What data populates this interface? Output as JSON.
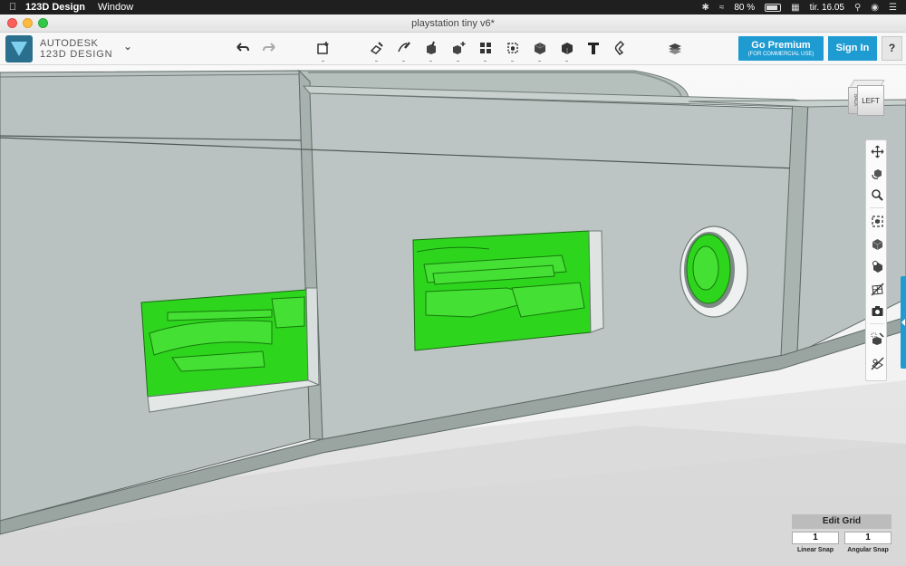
{
  "menubar": {
    "app_name": "123D Design",
    "menu": [
      "Window"
    ],
    "battery_percent": "80 %",
    "clock": "tir. 16.05"
  },
  "window": {
    "title": "playstation tiny v6*"
  },
  "brand": {
    "line1": "AUTODESK",
    "line2": "123D DESIGN"
  },
  "toolbar": {
    "tools": [
      "undo-icon",
      "redo-icon",
      "primitives-icon",
      "sketch-icon",
      "construct-icon",
      "modify-icon",
      "pattern-icon",
      "grouping-icon",
      "combine-icon",
      "measure-icon",
      "text-icon",
      "snap-icon",
      "material-icon"
    ]
  },
  "premium": {
    "label": "Go Premium",
    "sublabel": "(FOR COMMERCIAL USE)"
  },
  "signin": {
    "label": "Sign In"
  },
  "help": {
    "label": "?"
  },
  "viewcube": {
    "front_label": "LEFT",
    "side_label": "BACK"
  },
  "navbar": {
    "tools": [
      "pan-icon",
      "orbit-icon",
      "zoom-icon",
      "fit-icon",
      "perspective-icon",
      "visual-style-icon",
      "hide-mesh-icon",
      "camera-icon",
      "materials-outline-icon",
      "hide-grid-icon"
    ]
  },
  "edit_grid": {
    "title": "Edit Grid",
    "linear_value": "1",
    "angular_value": "1",
    "linear_label": "Linear Snap",
    "angular_label": "Angular Snap"
  },
  "colors": {
    "model_face": "#b9c2c0",
    "model_dark": "#9aa5a2",
    "highlight_green": "#2dd51d",
    "accent_blue": "#1e9bd1"
  }
}
